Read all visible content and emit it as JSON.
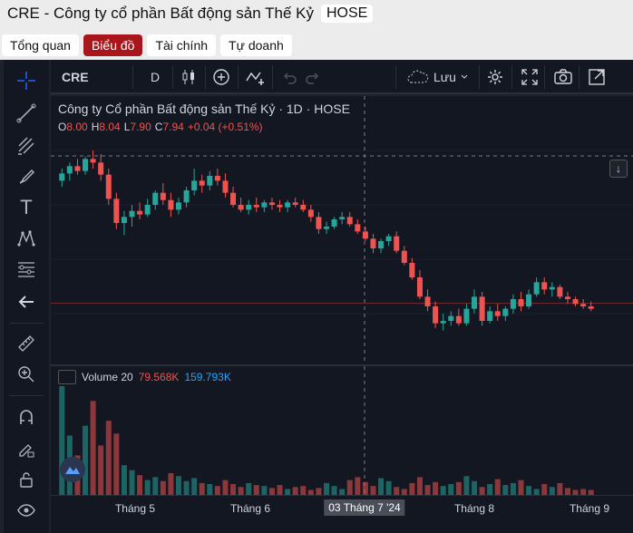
{
  "header": {
    "title": "CRE - Công ty cổ phần Bất động sản Thế Kỷ",
    "exchange_badge": "HOSE"
  },
  "tabs": [
    {
      "label": "Tổng quan",
      "active": false
    },
    {
      "label": "Biểu đồ",
      "active": true
    },
    {
      "label": "Tài chính",
      "active": false
    },
    {
      "label": "Tự doanh",
      "active": false
    }
  ],
  "toolbar": {
    "symbol": "CRE",
    "interval": "D",
    "save_label": "Lưu",
    "icons": [
      "candles-icon",
      "add-indicator-icon",
      "compare-icon",
      "undo-icon",
      "redo-icon",
      "cloud-icon",
      "settings-icon",
      "fullscreen-icon",
      "camera-icon",
      "popout-icon"
    ]
  },
  "left_tools": [
    "crosshair-icon",
    "trendline-icon",
    "pitchfork-icon",
    "brush-icon",
    "text-icon",
    "pattern-icon",
    "fib-icon",
    "back-arrow-icon",
    "ruler-icon",
    "zoom-icon",
    "magnet-icon",
    "lock-draw-icon",
    "lock-icon",
    "eye-icon"
  ],
  "legend": {
    "name": "Công ty Cổ phần Bất động sản Thế Kỷ · 1D · HOSE",
    "o_label": "O",
    "o": "8.00",
    "h_label": "H",
    "h": "8.04",
    "l_label": "L",
    "l": "7.90",
    "c_label": "C",
    "c": "7.94",
    "change": "+0.04 (+0.51%)"
  },
  "volume_legend": {
    "label": "Volume 20",
    "v1": "79.568K",
    "v2": "159.793K"
  },
  "xaxis": {
    "labels": [
      {
        "text": "Tháng 5",
        "highlight": false
      },
      {
        "text": "Tháng 6",
        "highlight": false
      },
      {
        "text": "03 Tháng 7 '24",
        "highlight": true
      },
      {
        "text": "Tháng 8",
        "highlight": false
      },
      {
        "text": "Tháng 9",
        "highlight": false
      }
    ]
  },
  "colors": {
    "up": "#26a69a",
    "down": "#ef5350",
    "bg": "#131722",
    "accent_tab": "#a8151b"
  },
  "chart_data": {
    "type": "candlestick",
    "y_range": [
      7.0,
      8.6
    ],
    "candles": [
      [
        8.0,
        8.1,
        7.95,
        8.06
      ],
      [
        8.06,
        8.15,
        8.0,
        8.12
      ],
      [
        8.12,
        8.18,
        8.05,
        8.08
      ],
      [
        8.08,
        8.2,
        8.05,
        8.18
      ],
      [
        8.18,
        8.25,
        8.1,
        8.15
      ],
      [
        8.15,
        8.22,
        8.0,
        8.05
      ],
      [
        8.05,
        8.1,
        7.8,
        7.85
      ],
      [
        7.85,
        7.9,
        7.6,
        7.65
      ],
      [
        7.65,
        7.75,
        7.55,
        7.7
      ],
      [
        7.7,
        7.8,
        7.62,
        7.75
      ],
      [
        7.75,
        7.82,
        7.68,
        7.72
      ],
      [
        7.72,
        7.85,
        7.7,
        7.8
      ],
      [
        7.8,
        7.92,
        7.76,
        7.9
      ],
      [
        7.9,
        7.98,
        7.8,
        7.84
      ],
      [
        7.84,
        7.9,
        7.7,
        7.76
      ],
      [
        7.76,
        7.86,
        7.72,
        7.82
      ],
      [
        7.82,
        7.95,
        7.78,
        7.92
      ],
      [
        7.92,
        8.1,
        7.88,
        8.0
      ],
      [
        8.0,
        8.05,
        7.9,
        7.96
      ],
      [
        7.96,
        8.08,
        7.92,
        8.04
      ],
      [
        8.04,
        8.1,
        7.96,
        8.0
      ],
      [
        8.0,
        8.06,
        7.86,
        7.9
      ],
      [
        7.9,
        7.95,
        7.78,
        7.8
      ],
      [
        7.8,
        7.86,
        7.74,
        7.76
      ],
      [
        7.76,
        7.84,
        7.72,
        7.8
      ],
      [
        7.8,
        7.86,
        7.74,
        7.78
      ],
      [
        7.78,
        7.84,
        7.74,
        7.82
      ],
      [
        7.82,
        7.86,
        7.76,
        7.8
      ],
      [
        7.8,
        7.84,
        7.74,
        7.78
      ],
      [
        7.78,
        7.84,
        7.74,
        7.82
      ],
      [
        7.82,
        7.86,
        7.78,
        7.8
      ],
      [
        7.8,
        7.84,
        7.74,
        7.76
      ],
      [
        7.76,
        7.8,
        7.66,
        7.7
      ],
      [
        7.7,
        7.74,
        7.56,
        7.6
      ],
      [
        7.6,
        7.66,
        7.56,
        7.62
      ],
      [
        7.62,
        7.7,
        7.6,
        7.68
      ],
      [
        7.68,
        7.74,
        7.64,
        7.7
      ],
      [
        7.7,
        7.74,
        7.62,
        7.64
      ],
      [
        7.64,
        7.68,
        7.56,
        7.58
      ],
      [
        7.58,
        7.62,
        7.5,
        7.52
      ],
      [
        7.52,
        7.56,
        7.4,
        7.44
      ],
      [
        7.44,
        7.52,
        7.4,
        7.5
      ],
      [
        7.5,
        7.56,
        7.46,
        7.54
      ],
      [
        7.54,
        7.58,
        7.4,
        7.42
      ],
      [
        7.42,
        7.46,
        7.3,
        7.32
      ],
      [
        7.32,
        7.36,
        7.18,
        7.2
      ],
      [
        7.2,
        7.26,
        7.02,
        7.04
      ],
      [
        7.04,
        7.1,
        6.92,
        6.96
      ],
      [
        6.96,
        7.0,
        6.78,
        6.82
      ],
      [
        6.82,
        6.9,
        6.76,
        6.84
      ],
      [
        6.84,
        6.92,
        6.8,
        6.88
      ],
      [
        6.88,
        6.94,
        6.8,
        6.82
      ],
      [
        6.82,
        6.98,
        6.8,
        6.94
      ],
      [
        6.94,
        7.1,
        6.9,
        7.04
      ],
      [
        7.04,
        7.08,
        6.8,
        6.84
      ],
      [
        6.84,
        6.96,
        6.82,
        6.92
      ],
      [
        6.92,
        6.98,
        6.84,
        6.88
      ],
      [
        6.88,
        6.96,
        6.84,
        6.94
      ],
      [
        6.94,
        7.06,
        6.9,
        7.02
      ],
      [
        7.02,
        7.08,
        6.92,
        6.96
      ],
      [
        6.96,
        7.1,
        6.94,
        7.06
      ],
      [
        7.06,
        7.2,
        7.04,
        7.16
      ],
      [
        7.16,
        7.2,
        7.06,
        7.1
      ],
      [
        7.1,
        7.16,
        7.04,
        7.12
      ],
      [
        7.12,
        7.14,
        7.02,
        7.04
      ],
      [
        7.04,
        7.08,
        6.98,
        7.02
      ],
      [
        7.02,
        7.04,
        6.96,
        6.98
      ],
      [
        6.98,
        7.02,
        6.94,
        6.96
      ],
      [
        6.96,
        7.0,
        6.92,
        6.94
      ]
    ],
    "volumes": [
      110,
      60,
      40,
      70,
      95,
      50,
      75,
      62,
      30,
      25,
      20,
      15,
      18,
      14,
      22,
      19,
      14,
      17,
      12,
      11,
      9,
      15,
      11,
      8,
      12,
      10,
      9,
      7,
      10,
      6,
      8,
      9,
      5,
      7,
      12,
      9,
      6,
      15,
      18,
      13,
      9,
      17,
      14,
      8,
      6,
      12,
      18,
      10,
      13,
      9,
      11,
      13,
      19,
      14,
      8,
      11,
      16,
      10,
      12,
      15,
      9,
      6,
      11,
      8,
      12,
      7,
      5,
      6,
      5
    ]
  }
}
